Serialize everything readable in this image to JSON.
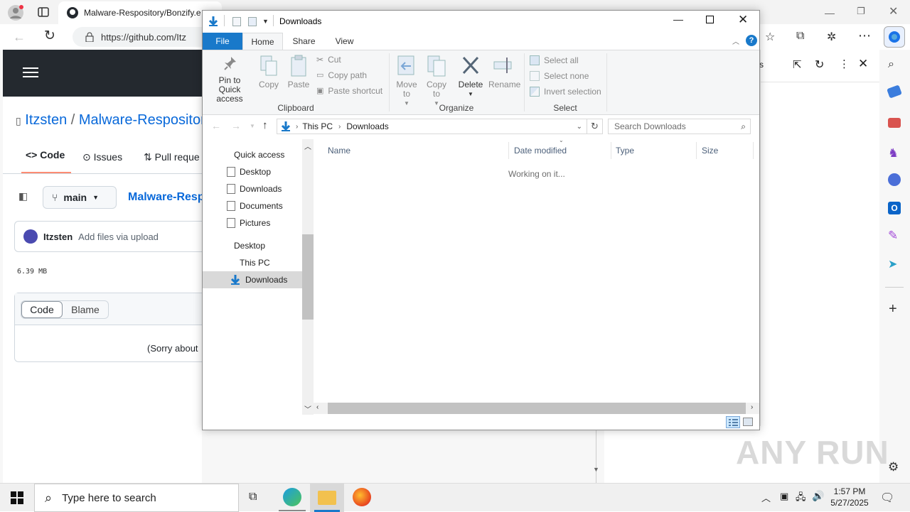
{
  "browser": {
    "tab_title": "Malware-Respository/Bonzify.e",
    "url": "https://github.com/Itz",
    "github": {
      "owner": "Itzsten",
      "slash": "/",
      "repo": "Malware-Respositor",
      "tabs": [
        "Code",
        "Issues",
        "Pull reque"
      ],
      "branch": "main",
      "breadcrumb_repo": "Malware-Resp",
      "commit_author": "Itzsten",
      "commit_message": "Add files via upload",
      "file_size": "6.39 MB",
      "view_buttons": [
        "Code",
        "Blame"
      ],
      "message": "(Sorry about"
    },
    "side_panel_fragment": "s"
  },
  "explorer": {
    "title": "Downloads",
    "ribbon_tabs": [
      "File",
      "Home",
      "Share",
      "View"
    ],
    "clipboard": {
      "pin": "Pin to Quick access",
      "copy": "Copy",
      "paste": "Paste",
      "cut": "Cut",
      "copy_path": "Copy path",
      "paste_shortcut": "Paste shortcut",
      "label": "Clipboard"
    },
    "organize": {
      "move_to": "Move to",
      "copy_to": "Copy to",
      "delete": "Delete",
      "rename": "Rename",
      "label": "Organize"
    },
    "select": {
      "select_all": "Select all",
      "select_none": "Select none",
      "invert": "Invert selection",
      "label": "Select"
    },
    "path": [
      "This PC",
      "Downloads"
    ],
    "search_placeholder": "Search Downloads",
    "nav": {
      "quick_access": "Quick access",
      "items": [
        "Desktop",
        "Downloads",
        "Documents",
        "Pictures"
      ],
      "desktop": "Desktop",
      "this_pc": "This PC",
      "downloads": "Downloads"
    },
    "columns": [
      "Name",
      "Date modified",
      "Type",
      "Size"
    ],
    "status": "Working on it..."
  },
  "taskbar": {
    "search_placeholder": "Type here to search",
    "time": "1:57 PM",
    "date": "5/27/2025"
  },
  "watermark": "ANY RUN",
  "colors": {
    "accent_blue": "#1979ca",
    "github_dark": "#24292f",
    "selection": "#cce8ff"
  }
}
